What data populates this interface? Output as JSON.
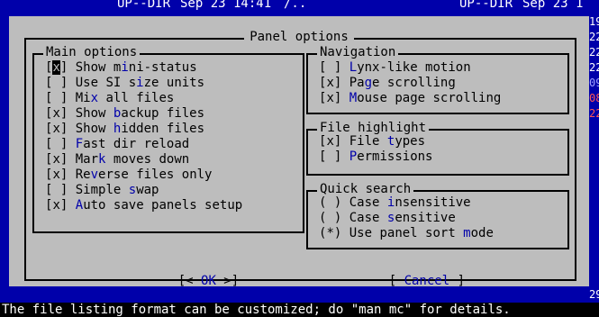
{
  "background": {
    "top_left_text": "UP--DIR",
    "top_date_left": "Sep 23 14:41",
    "top_path": "/..",
    "top_right_text": "UP--DIR",
    "top_date_right": "Sep 23 1",
    "right_frags": [
      "19",
      "22",
      "22",
      "22",
      "09",
      "08",
      "22"
    ],
    "right_bottom_frag": "29"
  },
  "dialog": {
    "title": "Panel options",
    "main_options": {
      "title": "Main options",
      "items": [
        {
          "mark": "[",
          "check": "x",
          "end": "]",
          "pre": " Show m",
          "hk": "i",
          "post": "ni-status"
        },
        {
          "mark": "[",
          "check": " ",
          "end": "]",
          "pre": " Use SI s",
          "hk": "i",
          "post": "ze units"
        },
        {
          "mark": "[",
          "check": " ",
          "end": "]",
          "pre": " Mi",
          "hk": "x",
          "post": " all files"
        },
        {
          "mark": "[",
          "check": "x",
          "end": "]",
          "pre": " Show ",
          "hk": "b",
          "post": "ackup files"
        },
        {
          "mark": "[",
          "check": "x",
          "end": "]",
          "pre": " Show ",
          "hk": "h",
          "post": "idden files"
        },
        {
          "mark": "[",
          "check": " ",
          "end": "]",
          "pre": " ",
          "hk": "F",
          "post": "ast dir reload"
        },
        {
          "mark": "[",
          "check": "x",
          "end": "]",
          "pre": " Mar",
          "hk": "k",
          "post": " moves down"
        },
        {
          "mark": "[",
          "check": "x",
          "end": "]",
          "pre": " Re",
          "hk": "v",
          "post": "erse files only"
        },
        {
          "mark": "[",
          "check": " ",
          "end": "]",
          "pre": " Simple ",
          "hk": "s",
          "post": "wap"
        },
        {
          "mark": "[",
          "check": "x",
          "end": "]",
          "pre": " ",
          "hk": "A",
          "post": "uto save panels setup"
        }
      ]
    },
    "navigation": {
      "title": "Navigation",
      "items": [
        {
          "mark": "[",
          "check": " ",
          "end": "]",
          "pre": " ",
          "hk": "L",
          "post": "ynx-like motion"
        },
        {
          "mark": "[",
          "check": "x",
          "end": "]",
          "pre": " Pa",
          "hk": "g",
          "post": "e scrolling"
        },
        {
          "mark": "[",
          "check": "x",
          "end": "]",
          "pre": " ",
          "hk": "M",
          "post": "ouse page scrolling"
        }
      ]
    },
    "file_highlight": {
      "title": "File highlight",
      "items": [
        {
          "mark": "[",
          "check": "x",
          "end": "]",
          "pre": " File ",
          "hk": "t",
          "post": "ypes"
        },
        {
          "mark": "[",
          "check": " ",
          "end": "]",
          "pre": " ",
          "hk": "P",
          "post": "ermissions"
        }
      ]
    },
    "quick_search": {
      "title": "Quick search",
      "items": [
        {
          "mark": "(",
          "check": " ",
          "end": ")",
          "pre": " Case ",
          "hk": "i",
          "post": "nsensitive"
        },
        {
          "mark": "(",
          "check": " ",
          "end": ")",
          "pre": " Case ",
          "hk": "s",
          "post": "ensitive"
        },
        {
          "mark": "(",
          "check": "*",
          "end": ")",
          "pre": " Use panel sort ",
          "hk": "m",
          "post": "ode"
        }
      ]
    },
    "ok_button": {
      "left": "[< ",
      "label": "OK",
      "right": " >]"
    },
    "cancel_button": {
      "left": "[ ",
      "label": "Cancel",
      "right": " ]"
    }
  },
  "status_bar": "The file listing format can be customized; do \"man mc\" for details."
}
